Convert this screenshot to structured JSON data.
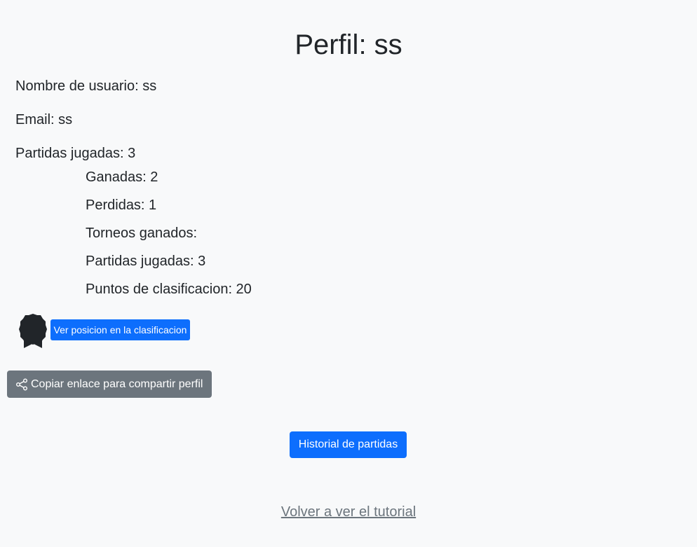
{
  "profile": {
    "title": "Perfil: ss",
    "username_line": "Nombre de usuario: ss",
    "email_line": "Email: ss",
    "games_played_line": "Partidas jugadas: 3"
  },
  "stats": {
    "won": "Ganadas: 2",
    "lost": "Perdidas: 1",
    "tournaments_won": "Torneos ganados:",
    "games_played": "Partidas jugadas: 3",
    "ranking_points": "Puntos de clasificacion: 20"
  },
  "actions": {
    "ranking_button": "Ver posicion en la clasificacion",
    "share_button": "Copiar enlace para compartir perfil",
    "history_button": "Historial de partidas",
    "tutorial_link": "Volver a ver el tutorial"
  },
  "icons": {
    "badge": "award-badge-icon",
    "share": "share-icon"
  },
  "colors": {
    "primary": "#0d6efd",
    "secondary": "#6c757d",
    "background": "#f8f9fa",
    "text": "#212529"
  }
}
